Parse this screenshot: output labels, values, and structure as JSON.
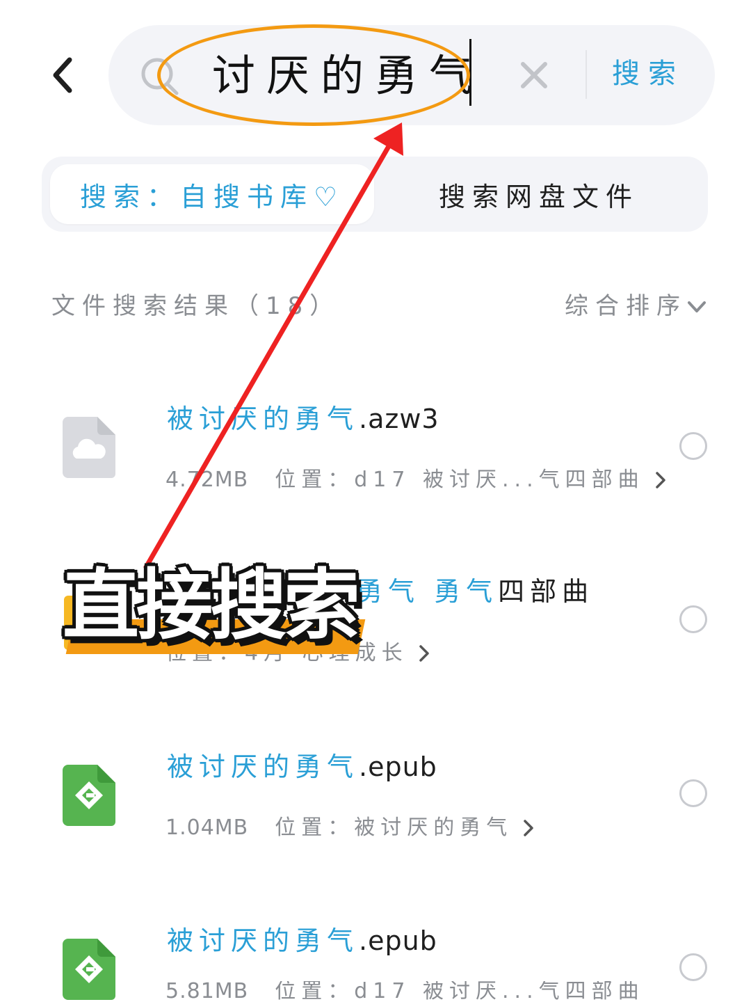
{
  "search": {
    "query": "讨厌的勇气",
    "submit_label": "搜索"
  },
  "tabs": [
    {
      "label": "搜索：自搜书库♡",
      "active": true
    },
    {
      "label": "搜索网盘文件",
      "active": false
    }
  ],
  "results_header": {
    "title": "文件搜索结果（18）",
    "sort_label": "综合排序"
  },
  "results": [
    {
      "name_highlight": "被讨厌的勇气",
      "name_suffix": ".azw3",
      "size": "4.72MB",
      "location": "位置：d17 被讨厌...气四部曲",
      "icon": "cloud-file-icon"
    },
    {
      "name_highlight": "勇气 勇气",
      "name_suffix": "四部曲",
      "size": "",
      "location": "位置：4月 心理成长",
      "icon": "folder-icon"
    },
    {
      "name_highlight": "被讨厌的勇气",
      "name_suffix": ".epub",
      "size": "1.04MB",
      "location": "位置：被讨厌的勇气",
      "icon": "epub-icon"
    },
    {
      "name_highlight": "被讨厌的勇气",
      "name_suffix": ".epub",
      "size": "5.81MB",
      "location": "位置：d17 被讨厌...气四部曲",
      "icon": "epub-icon"
    }
  ],
  "overlay": {
    "caption": "直接搜索",
    "accent_color": "#f39a12",
    "arrow_color": "#ee2222"
  },
  "colors": {
    "brand_blue": "#2a9fd6",
    "epub_green": "#56b450",
    "folder_yellow": "#f6b823"
  }
}
